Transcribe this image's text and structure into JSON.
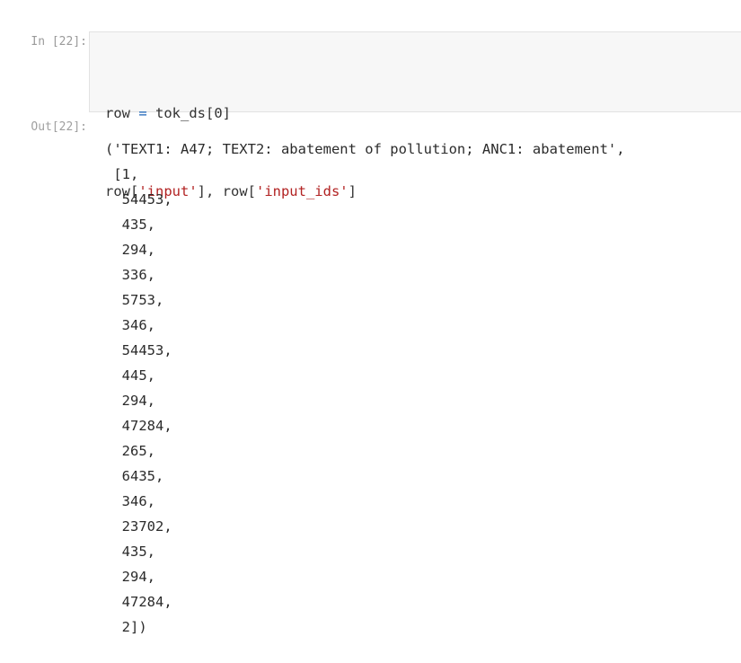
{
  "input_cell": {
    "prompt": "In [22]:",
    "line1": {
      "lhs": "row ",
      "op": "=",
      "rhs": " tok_ds[0]"
    },
    "line2": {
      "p1": "row[",
      "s1": "'input'",
      "p2": "], row[",
      "s2": "'input_ids'",
      "p3": "]"
    }
  },
  "output_cell": {
    "prompt": "Out[22]:",
    "lines": [
      "('TEXT1: A47; TEXT2: abatement of pollution; ANC1: abatement',",
      " [1,",
      "  54453,",
      "  435,",
      "  294,",
      "  336,",
      "  5753,",
      "  346,",
      "  54453,",
      "  445,",
      "  294,",
      "  47284,",
      "  265,",
      "  6435,",
      "  346,",
      "  23702,",
      "  435,",
      "  294,",
      "  47284,",
      "  2])"
    ]
  },
  "colors": {
    "operator": "#1b63b8",
    "string": "#b22222",
    "input_bg": "#f7f7f7"
  }
}
